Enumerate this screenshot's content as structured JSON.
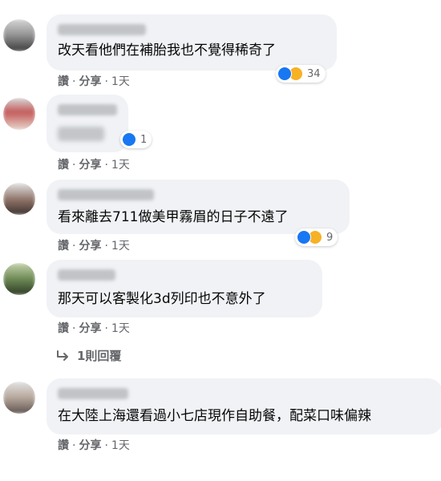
{
  "comments": [
    {
      "text": "改天看他們在補胎我也不覺得稀奇了",
      "actions": {
        "like": "讚",
        "share": "分享",
        "time": "1天"
      },
      "reaction_count": "34",
      "reactions": [
        "like-icon",
        "haha-icon"
      ]
    },
    {
      "text": "",
      "actions": {
        "like": "讚",
        "share": "分享",
        "time": "1天"
      },
      "reaction_count": "1",
      "reactions": [
        "like-icon"
      ]
    },
    {
      "text": "看來離去711做美甲霧眉的日子不遠了",
      "actions": {
        "like": "讚",
        "share": "分享",
        "time": "1天"
      },
      "reaction_count": "9",
      "reactions": [
        "like-icon",
        "haha-icon"
      ]
    },
    {
      "text": "那天可以客製化3d列印也不意外了",
      "actions": {
        "like": "讚",
        "share": "分享",
        "time": "1天"
      },
      "replies": "1則回覆"
    },
    {
      "text": "在大陸上海還看過小七店現作自助餐，配菜口味偏辣",
      "actions": {
        "like": "讚",
        "share": "分享",
        "time": "1天"
      }
    }
  ],
  "separator": "·",
  "colors": {
    "bubble": "#f0f2f5",
    "like": "#1877f2",
    "haha": "#f7b125",
    "meta": "#65676b"
  }
}
